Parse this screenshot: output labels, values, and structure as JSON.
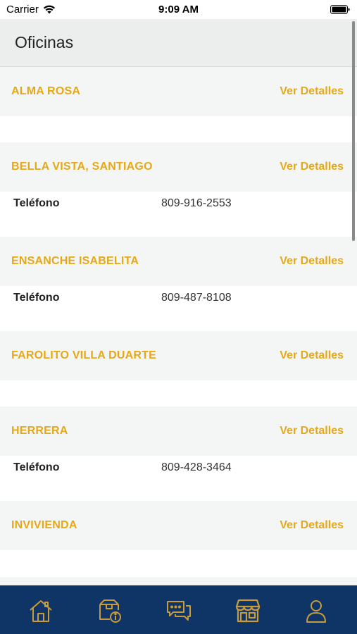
{
  "status": {
    "carrier": "Carrier",
    "time": "9:09 AM"
  },
  "header": {
    "title": "Oficinas"
  },
  "offices": [
    {
      "name": "ALMA ROSA",
      "link": "Ver Detalles"
    },
    {
      "name": "BELLA VISTA, SANTIAGO",
      "link": "Ver Detalles",
      "phone_label": "Teléfono",
      "phone": "809-916-2553"
    },
    {
      "name": "ENSANCHE ISABELITA",
      "link": "Ver Detalles",
      "phone_label": "Teléfono",
      "phone": "809-487-8108"
    },
    {
      "name": "FAROLITO VILLA DUARTE",
      "link": "Ver Detalles"
    },
    {
      "name": "HERRERA",
      "link": "Ver Detalles",
      "phone_label": "Teléfono",
      "phone": "809-428-3464"
    },
    {
      "name": "INVIVIENDA",
      "link": "Ver Detalles"
    }
  ],
  "tabbar": {
    "items": [
      "home-icon",
      "package-info-icon",
      "chat-icon",
      "store-icon",
      "profile-icon"
    ],
    "active": "store-icon",
    "background": "#0f3466",
    "icon_color": "#c89b3c"
  },
  "colors": {
    "accent": "#e6a817",
    "header_bg": "#eceeed",
    "row_bg": "#f3f6f5"
  }
}
